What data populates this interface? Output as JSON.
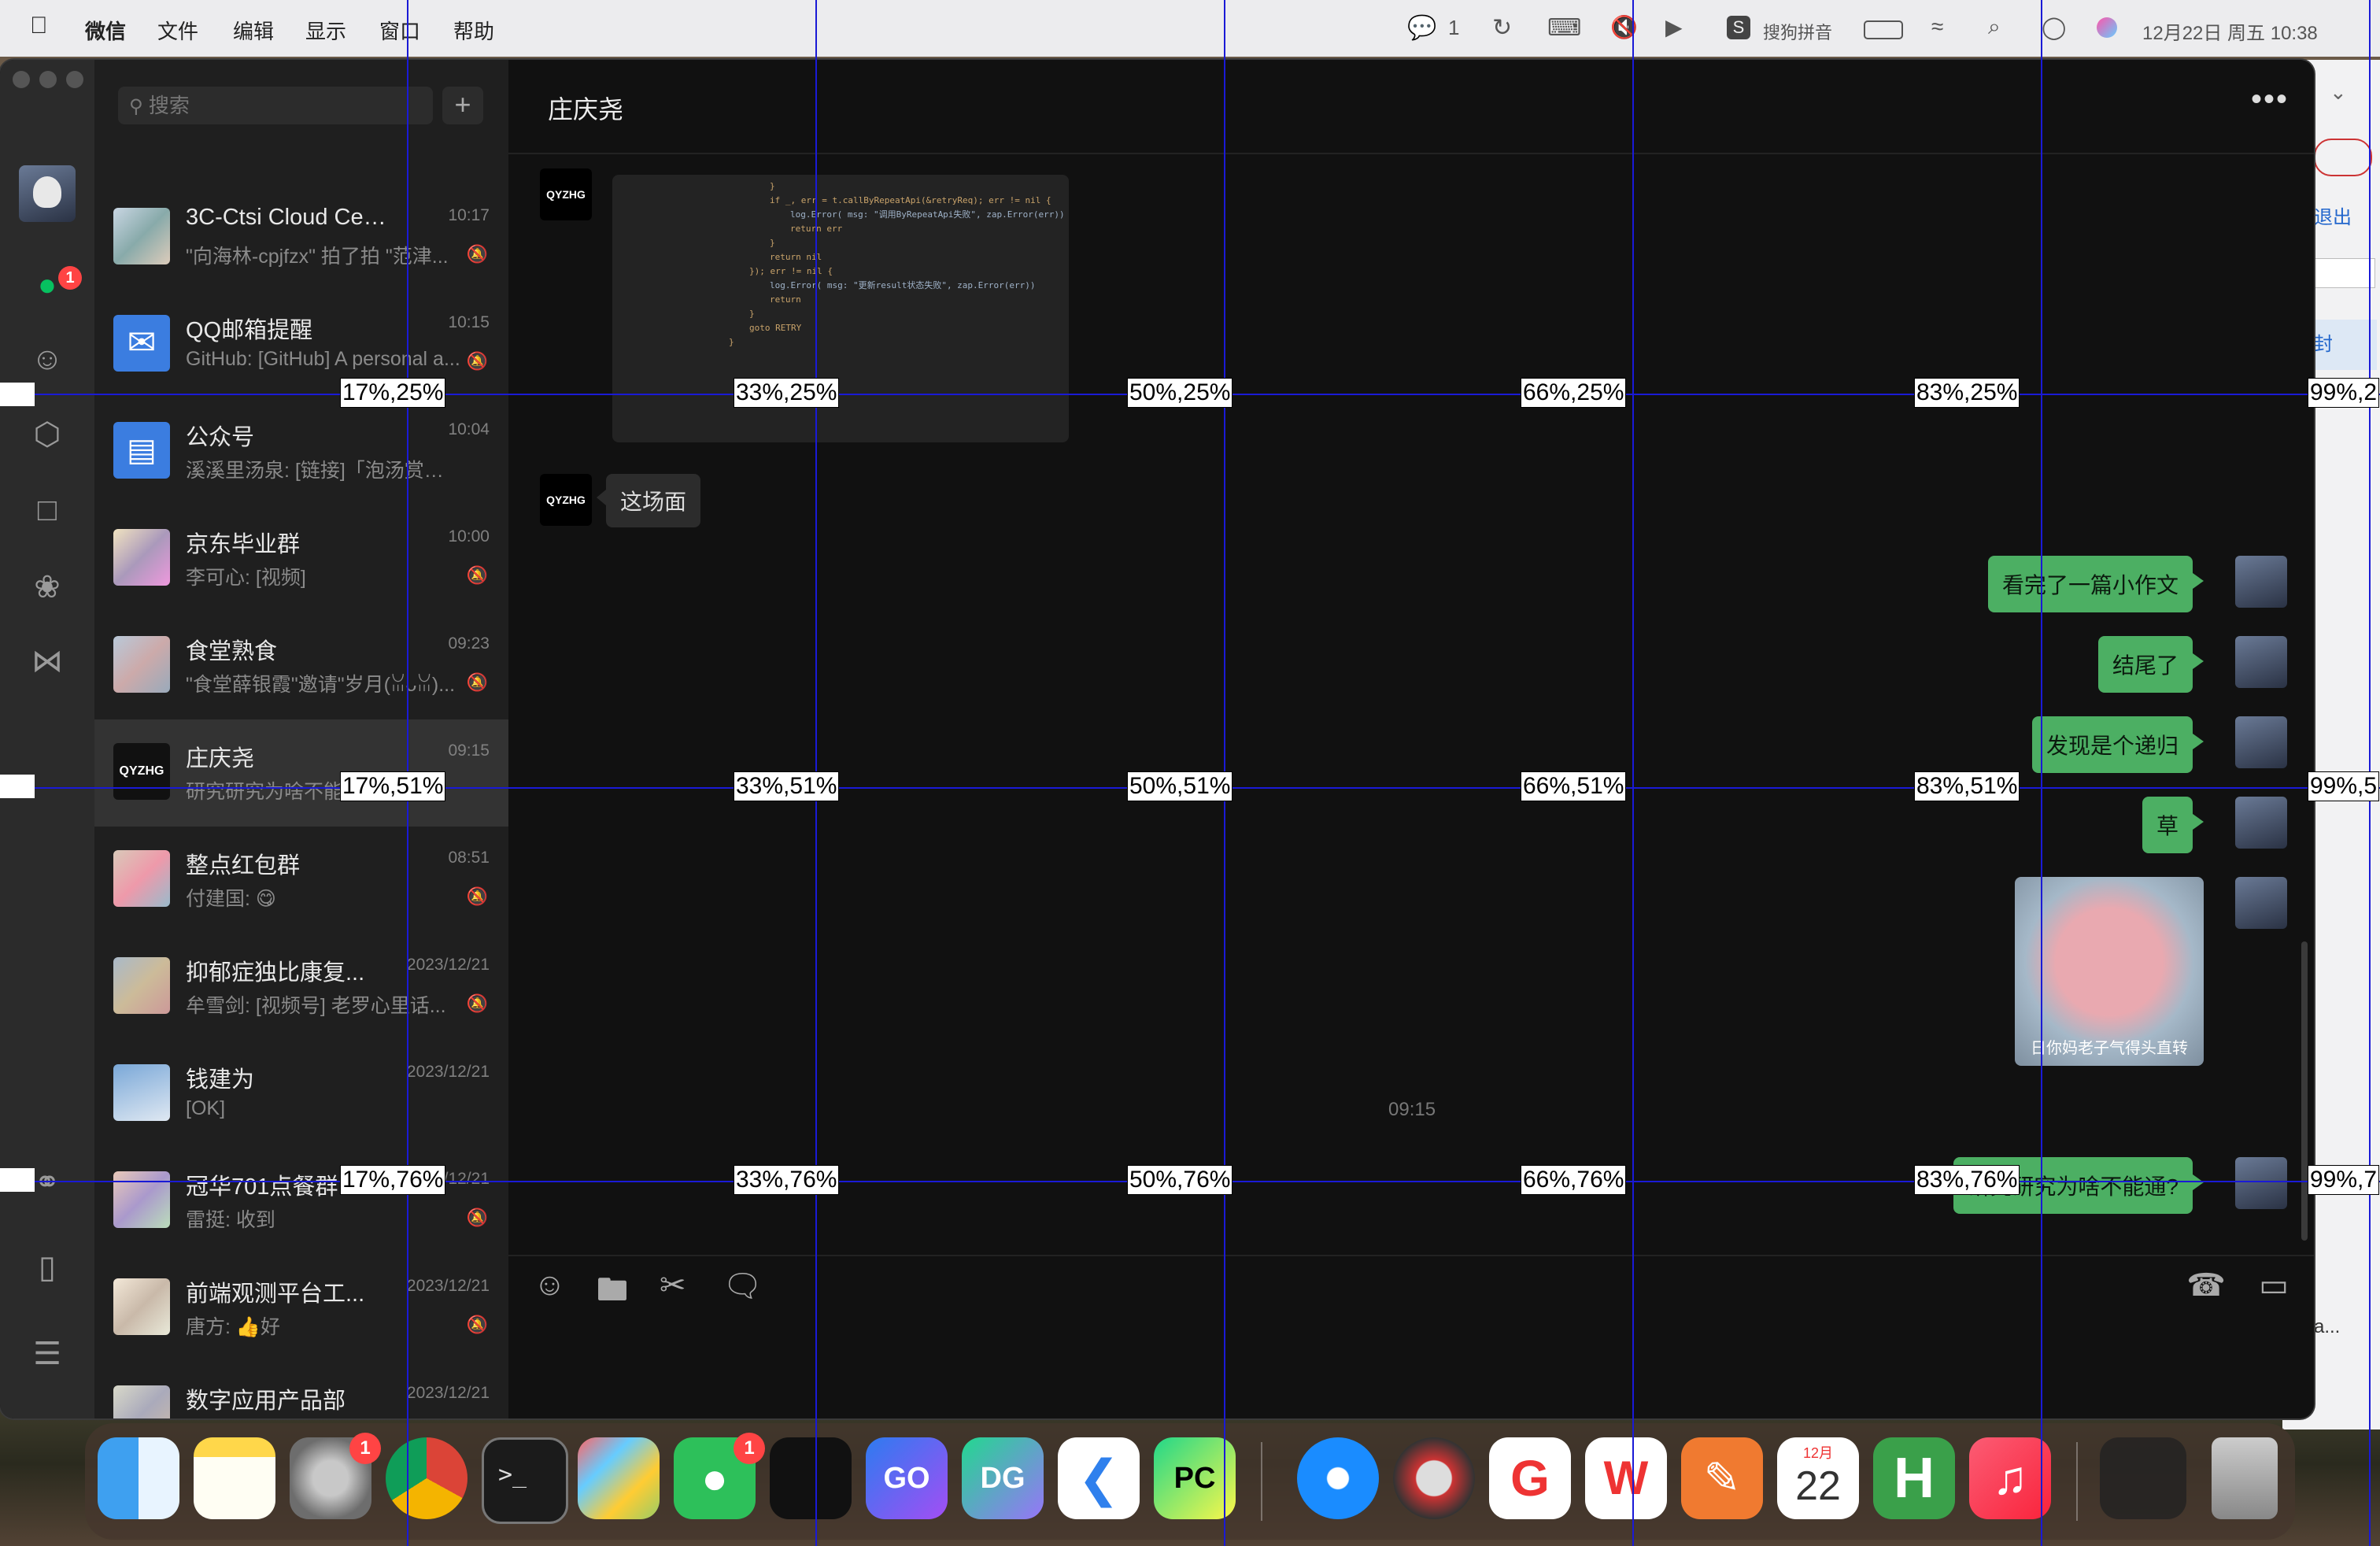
{
  "menubar": {
    "items": [
      "微信",
      "文件",
      "编辑",
      "显示",
      "窗口",
      "帮助"
    ],
    "wechat_count": "1",
    "ime": "搜狗拼音",
    "datetime": "12月22日 周五 10:38"
  },
  "sidebar_rail": {
    "chat_badge": "1"
  },
  "search": {
    "placeholder": "搜索"
  },
  "conversations": [
    {
      "title": "3C-Ctsi Cloud Center",
      "preview": "\"向海林-cpjfzx\" 拍了拍 \"范津...",
      "time": "10:17"
    },
    {
      "title": "QQ邮箱提醒",
      "preview": "GitHub: [GitHub] A personal a...",
      "time": "10:15"
    },
    {
      "title": "公众号",
      "preview": "溪溪里汤泉: [链接]「泡汤赏雪・...",
      "time": "10:04"
    },
    {
      "title": "京东毕业群",
      "preview": "李可心: [视频]",
      "time": "10:00"
    },
    {
      "title": "食堂熟食",
      "preview": "\"食堂薛银霞\"邀请\"岁月(ꈍᴗꈍ)...",
      "time": "09:23"
    },
    {
      "title": "庄庆尧",
      "preview": "研究研究为啥不能通?",
      "time": "09:15"
    },
    {
      "title": "整点红包群",
      "preview": "付建国: 😋",
      "time": "08:51"
    },
    {
      "title": "抑郁症独比康复...",
      "preview": "牟雪剑: [视频号] 老罗心里话...",
      "time": "2023/12/21"
    },
    {
      "title": "钱建为",
      "preview": "[OK]",
      "time": "2023/12/21"
    },
    {
      "title": "冠华701点餐群",
      "preview": "雷挺: 收到",
      "time": "2023/12/21"
    },
    {
      "title": "前端观测平台工...",
      "preview": "唐方: 👍好",
      "time": "2023/12/21"
    },
    {
      "title": "数字应用产品部",
      "preview": "",
      "time": "2023/12/21"
    }
  ],
  "chat": {
    "name": "庄庆尧",
    "messages_left": [
      "这场面"
    ],
    "messages_right": [
      "看完了一篇小作文",
      "结尾了",
      "发现是个递归",
      "草",
      "研究研究为啥不能通?"
    ],
    "sticker_caption": "日你妈老子气得头直转",
    "timestamp": "09:15",
    "avatar_text": "QYZHG",
    "code_lines": [
      "}",
      "if _, err = t.callByRepeatApi(&retryReq); err != nil {",
      "  log.Error( msg: \"调用ByRepeatApi失败\", zap.Error(err))",
      "  return err",
      "}",
      "return nil",
      "}); err != nil {",
      "  log.Error( msg: \"更新result状态失败\", zap.Error(err))",
      "  return",
      "}",
      "goto RETRY",
      "}"
    ]
  },
  "right_window": {
    "exit_label": "退出",
    "seal_label": "封",
    "ellipsis": "a..."
  },
  "dock": {
    "calendar_month": "12月",
    "calendar_day": "22",
    "settings_badge": "1",
    "wechat_badge": "1",
    "goland_label": "GO",
    "datagrip_label": "DG",
    "pycharm_label": "PC"
  },
  "grid_labels": {
    "r25": [
      "17%,25%",
      "33%,25%",
      "50%,25%",
      "66%,25%",
      "83%,25%",
      "99%,2"
    ],
    "r51": [
      "17%,51%",
      "33%,51%",
      "50%,51%",
      "66%,51%",
      "83%,51%",
      "99%,5"
    ],
    "r76": [
      "17%,76%",
      "33%,76%",
      "50%,76%",
      "66%,76%",
      "83%,76%",
      "99%,7"
    ]
  }
}
